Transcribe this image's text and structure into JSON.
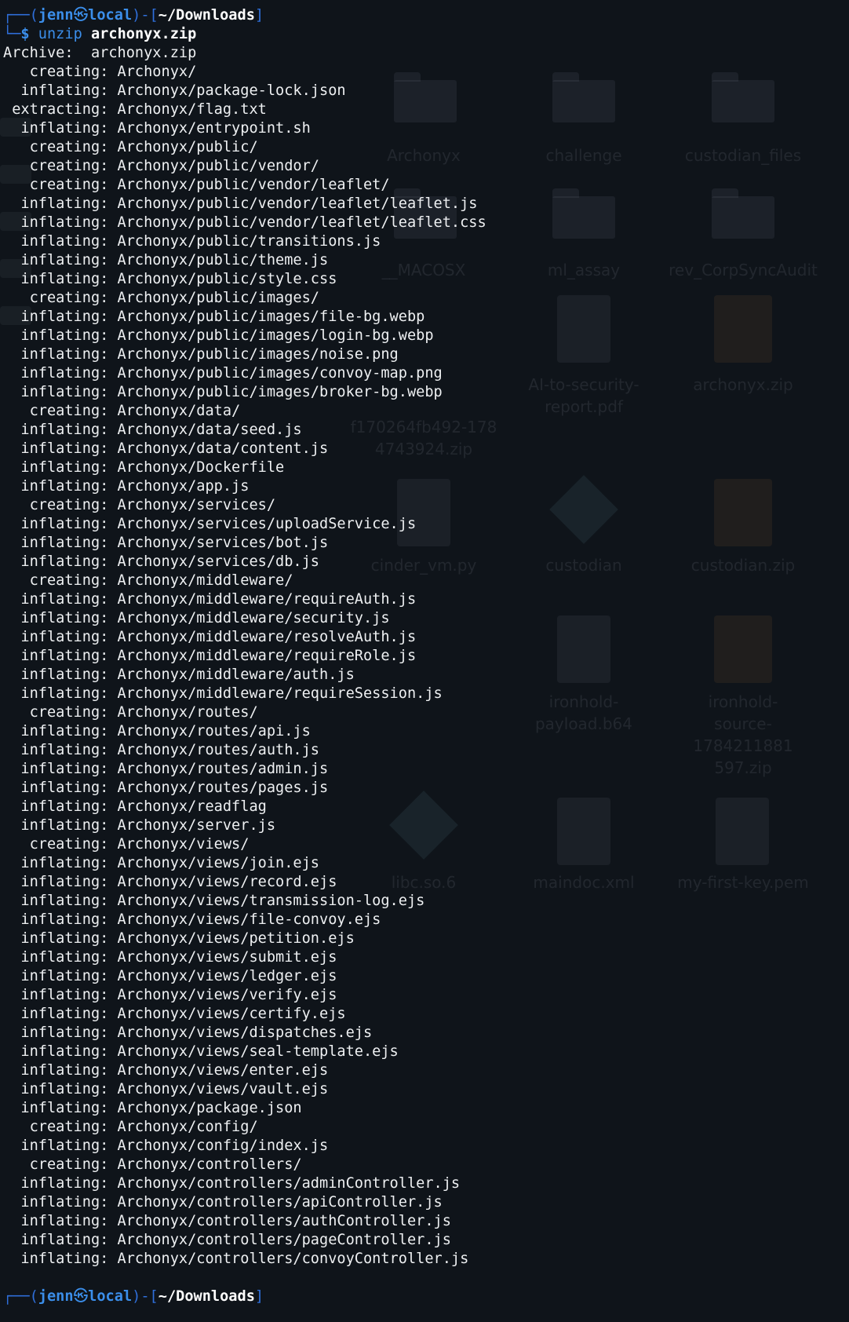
{
  "background_desktop": {
    "items": [
      {
        "label": "Archonyx",
        "icon": "folder-icon"
      },
      {
        "label": "challenge",
        "icon": "folder-icon"
      },
      {
        "label": "custodian_files",
        "icon": "folder-icon"
      },
      {
        "label": "__MACOSX",
        "icon": "folder-icon"
      },
      {
        "label": "ml_assay",
        "icon": "folder-icon"
      },
      {
        "label": "rev_CorpSyncAudit",
        "icon": "folder-icon"
      },
      {
        "label": "AI-to-security-\nreport.pdf",
        "icon": "pdf-file-icon"
      },
      {
        "label": "archonyx.zip",
        "icon": "archive-icon"
      },
      {
        "label": "f170264fb492-178\n4743924.zip",
        "icon": "archive-icon"
      },
      {
        "label": "cinder_vm.py",
        "icon": "python-file-icon"
      },
      {
        "label": "custodian",
        "icon": "executable-icon"
      },
      {
        "label": "custodian.zip",
        "icon": "archive-icon"
      },
      {
        "label": "ironhold-\npayload.b64",
        "icon": "file-icon"
      },
      {
        "label": "ironhold-\nsource-1784211881\n597.zip",
        "icon": "archive-icon"
      },
      {
        "label": "libc.so.6",
        "icon": "library-icon"
      },
      {
        "label": "maindoc.xml",
        "icon": "xml-file-icon"
      },
      {
        "label": "my-first-key.pem",
        "icon": "file-icon"
      }
    ]
  },
  "terminal": {
    "prompt": {
      "open": "┌──(",
      "user": "jenn",
      "at": "㉿",
      "host": "local",
      "mid": ")-[",
      "cwd": "~/Downloads",
      "close": "]",
      "second_prefix": "└─",
      "symbol": "$"
    },
    "command": "unzip",
    "argument": "archonyx.zip",
    "output": [
      "Archive:  archonyx.zip",
      "   creating: Archonyx/",
      "  inflating: Archonyx/package-lock.json",
      " extracting: Archonyx/flag.txt",
      "  inflating: Archonyx/entrypoint.sh",
      "   creating: Archonyx/public/",
      "   creating: Archonyx/public/vendor/",
      "   creating: Archonyx/public/vendor/leaflet/",
      "  inflating: Archonyx/public/vendor/leaflet/leaflet.js",
      "  inflating: Archonyx/public/vendor/leaflet/leaflet.css",
      "  inflating: Archonyx/public/transitions.js",
      "  inflating: Archonyx/public/theme.js",
      "  inflating: Archonyx/public/style.css",
      "   creating: Archonyx/public/images/",
      "  inflating: Archonyx/public/images/file-bg.webp",
      "  inflating: Archonyx/public/images/login-bg.webp",
      "  inflating: Archonyx/public/images/noise.png",
      "  inflating: Archonyx/public/images/convoy-map.png",
      "  inflating: Archonyx/public/images/broker-bg.webp",
      "   creating: Archonyx/data/",
      "  inflating: Archonyx/data/seed.js",
      "  inflating: Archonyx/data/content.js",
      "  inflating: Archonyx/Dockerfile",
      "  inflating: Archonyx/app.js",
      "   creating: Archonyx/services/",
      "  inflating: Archonyx/services/uploadService.js",
      "  inflating: Archonyx/services/bot.js",
      "  inflating: Archonyx/services/db.js",
      "   creating: Archonyx/middleware/",
      "  inflating: Archonyx/middleware/requireAuth.js",
      "  inflating: Archonyx/middleware/security.js",
      "  inflating: Archonyx/middleware/resolveAuth.js",
      "  inflating: Archonyx/middleware/requireRole.js",
      "  inflating: Archonyx/middleware/auth.js",
      "  inflating: Archonyx/middleware/requireSession.js",
      "   creating: Archonyx/routes/",
      "  inflating: Archonyx/routes/api.js",
      "  inflating: Archonyx/routes/auth.js",
      "  inflating: Archonyx/routes/admin.js",
      "  inflating: Archonyx/routes/pages.js",
      "  inflating: Archonyx/readflag",
      "  inflating: Archonyx/server.js",
      "   creating: Archonyx/views/",
      "  inflating: Archonyx/views/join.ejs",
      "  inflating: Archonyx/views/record.ejs",
      "  inflating: Archonyx/views/transmission-log.ejs",
      "  inflating: Archonyx/views/file-convoy.ejs",
      "  inflating: Archonyx/views/petition.ejs",
      "  inflating: Archonyx/views/submit.ejs",
      "  inflating: Archonyx/views/ledger.ejs",
      "  inflating: Archonyx/views/verify.ejs",
      "  inflating: Archonyx/views/certify.ejs",
      "  inflating: Archonyx/views/dispatches.ejs",
      "  inflating: Archonyx/views/seal-template.ejs",
      "  inflating: Archonyx/views/enter.ejs",
      "  inflating: Archonyx/views/vault.ejs",
      "  inflating: Archonyx/package.json",
      "   creating: Archonyx/config/",
      "  inflating: Archonyx/config/index.js",
      "   creating: Archonyx/controllers/",
      "  inflating: Archonyx/controllers/adminController.js",
      "  inflating: Archonyx/controllers/apiController.js",
      "  inflating: Archonyx/controllers/authController.js",
      "  inflating: Archonyx/controllers/pageController.js",
      "  inflating: Archonyx/controllers/convoyController.js"
    ]
  }
}
